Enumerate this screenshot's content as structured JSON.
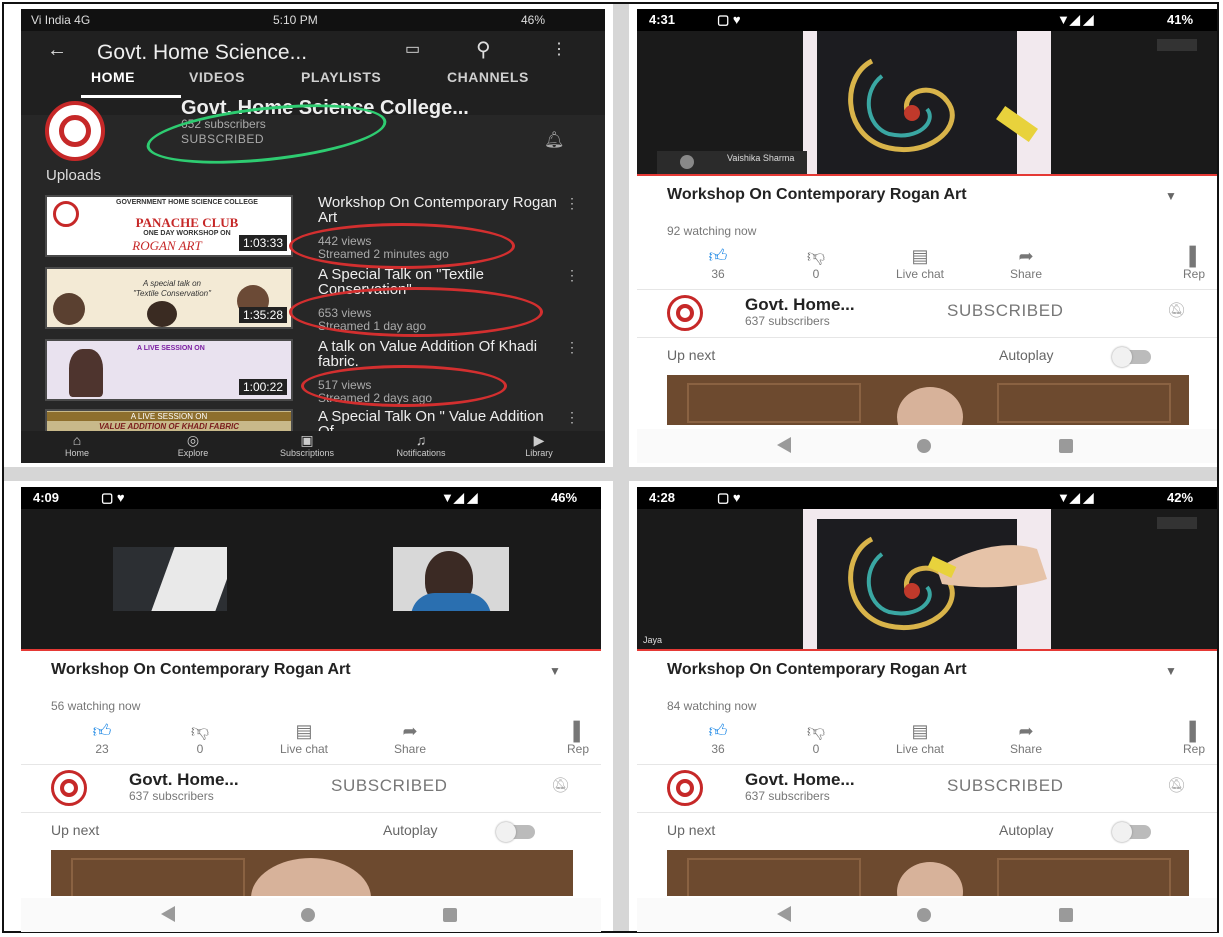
{
  "phone1": {
    "status": {
      "carrier": "Vi India 4G",
      "time": "5:10 PM",
      "battery": "46%"
    },
    "header_title": "Govt. Home Science...",
    "tabs": [
      "HOME",
      "VIDEOS",
      "PLAYLISTS",
      "CHANNELS"
    ],
    "channel_name": "Govt. Home Science College...",
    "subscribers": "652 subscribers",
    "subscribed_label": "SUBSCRIBED",
    "uploads_label": "Uploads",
    "videos": [
      {
        "title": "Workshop On Contemporary Rogan Art",
        "views": "442 views",
        "streamed": "Streamed 2 minutes ago",
        "duration": "1:03:33",
        "thumb_text": [
          "GOVERNMENT HOME SCIENCE COLLEGE",
          "PANACHE CLUB",
          "ONE DAY WORKSHOP ON",
          "ROGAN ART"
        ]
      },
      {
        "title": "A Special Talk on \"Textile Conservation\"",
        "views": "653 views",
        "streamed": "Streamed 1 day ago",
        "duration": "1:35:28",
        "thumb_text": [
          "A special talk on",
          "\"Textile Conservation\""
        ]
      },
      {
        "title": "A talk on Value Addition Of Khadi fabric.",
        "views": "517 views",
        "streamed": "Streamed 2 days ago",
        "duration": "1:00:22",
        "thumb_text": [
          "A LIVE SESSION ON"
        ]
      },
      {
        "title": "A Special Talk On \" Value Addition Of",
        "views": "",
        "streamed": "",
        "duration": "",
        "thumb_text": [
          "A LIVE SESSION ON",
          "VALUE ADDITION OF KHADI FABRIC"
        ]
      }
    ],
    "nav": [
      "Home",
      "Explore",
      "Subscriptions",
      "Notifications",
      "Library"
    ]
  },
  "phone2": {
    "status": {
      "time": "4:31",
      "battery": "41%"
    },
    "video_caption": "Vaishika Sharma",
    "title": "Workshop On Contemporary Rogan Art",
    "watching": "92 watching now",
    "likes": "36",
    "dislikes": "0",
    "live_chat": "Live chat",
    "share": "Share",
    "rep": "Rep",
    "channel": "Govt. Home...",
    "subs": "637 subscribers",
    "subscribed": "SUBSCRIBED",
    "up_next": "Up next",
    "autoplay": "Autoplay"
  },
  "phone3": {
    "status": {
      "time": "4:09",
      "battery": "46%"
    },
    "title": "Workshop On Contemporary Rogan Art",
    "watching": "56 watching now",
    "likes": "23",
    "dislikes": "0",
    "live_chat": "Live chat",
    "share": "Share",
    "rep": "Rep",
    "channel": "Govt. Home...",
    "subs": "637 subscribers",
    "subscribed": "SUBSCRIBED",
    "up_next": "Up next",
    "autoplay": "Autoplay"
  },
  "phone4": {
    "status": {
      "time": "4:28",
      "battery": "42%"
    },
    "video_caption": "Jaya",
    "title": "Workshop On Contemporary Rogan Art",
    "watching": "84 watching now",
    "likes": "36",
    "dislikes": "0",
    "live_chat": "Live chat",
    "share": "Share",
    "rep": "Rep",
    "channel": "Govt. Home...",
    "subs": "637 subscribers",
    "subscribed": "SUBSCRIBED",
    "up_next": "Up next",
    "autoplay": "Autoplay"
  },
  "colors": {
    "accent_red": "#e53935",
    "like_blue": "#1e88e5",
    "dark_bg": "#272727",
    "annotation_green": "#2ecc71",
    "annotation_red": "#d32f2f"
  }
}
